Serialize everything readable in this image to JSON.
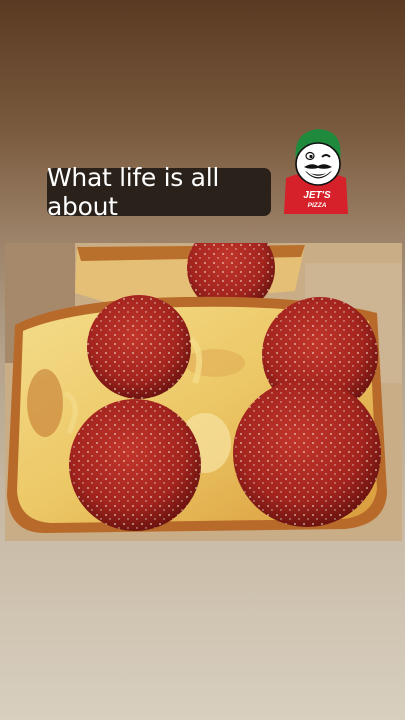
{
  "story": {
    "caption_text": "What life is all about",
    "sticker": {
      "icon": "jets-pizza-logo-icon",
      "wordmark": "JET'S PIZZA",
      "colors": {
        "red": "#d6202a",
        "green": "#1f8a3c",
        "white": "#ffffff"
      }
    },
    "photo": {
      "subject": "pizza-photo",
      "accent_colors": {
        "pepperoni": "#a3241e",
        "cheese": "#f2d57a",
        "crust": "#b86a2a",
        "box": "#c9ad86"
      }
    }
  }
}
